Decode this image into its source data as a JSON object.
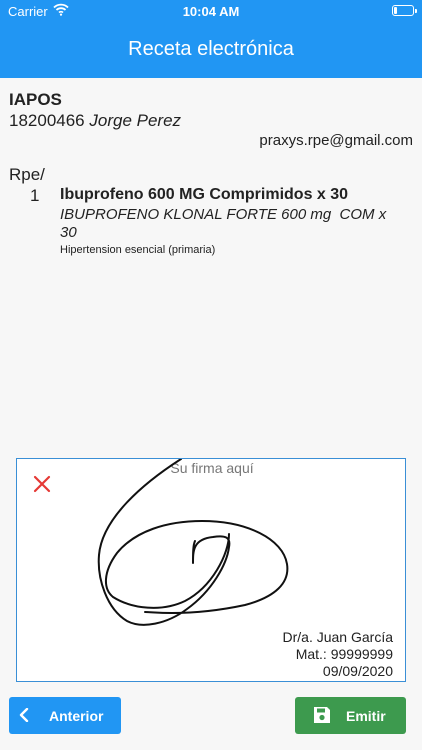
{
  "status_bar": {
    "carrier": "Carrier",
    "time": "10:04 AM",
    "battery_level": 0.15
  },
  "header": {
    "title": "Receta electrónica"
  },
  "patient": {
    "insurer": "IAPOS",
    "id": "18200466",
    "name": "Jorge Perez",
    "email": "praxys.rpe@gmail.com"
  },
  "prescription": {
    "rpe_label": "Rpe/",
    "items": [
      {
        "number": "1",
        "drug_name": "Ibuprofeno 600 MG Comprimidos x 30",
        "drug_detail": "IBUPROFENO KLONAL FORTE 600 mg  COM x   30",
        "diagnosis": "Hipertension esencial (primaria)"
      }
    ]
  },
  "signature": {
    "placeholder": "Su firma aquí",
    "doctor": "Dr/a. Juan García",
    "license": "Mat.: 99999999",
    "date": "09/09/2020",
    "clear_icon": "close-icon",
    "accent_color": "#e53935"
  },
  "actions": {
    "prev_label": "Anterior",
    "prev_icon": "chevron-left-icon",
    "emit_label": "Emitir",
    "emit_icon": "save-icon"
  },
  "colors": {
    "primary": "#2196f3",
    "success": "#3d9a4e"
  }
}
